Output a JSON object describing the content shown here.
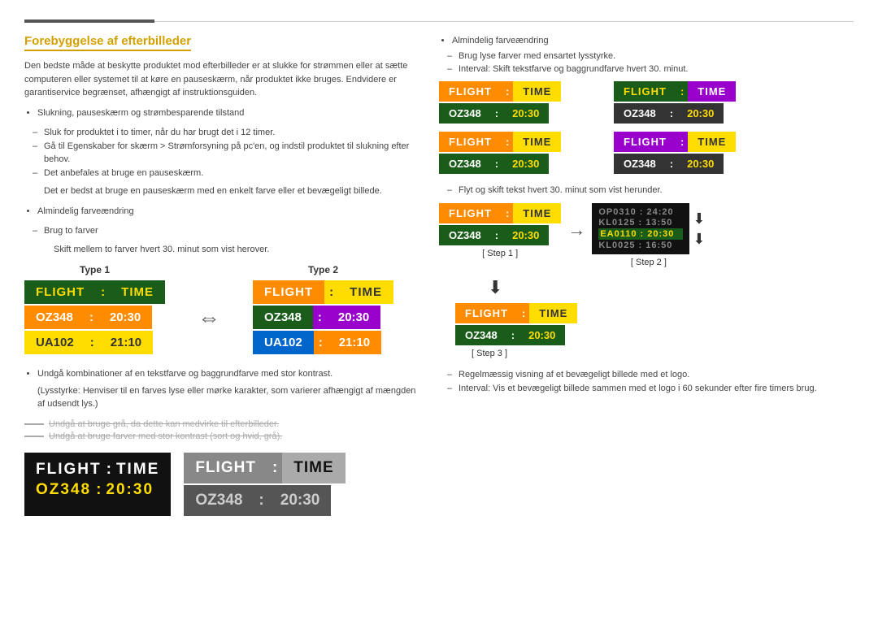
{
  "page": {
    "title": "Forebyggelse af efterbilleder"
  },
  "header": {
    "intro": "Den bedste måde at beskytte produktet mod efterbilleder er at slukke for strømmen eller at sætte computeren eller systemet til at køre en pauseskærm, når produktet ikke bruges. Endvidere er garantiservice begrænset, afhængigt af instruktionsguiden."
  },
  "left": {
    "bullet1": "Slukning, pauseskærm og strømbesparende tilstand",
    "dash1a": "Sluk for produktet i to timer, når du har brugt det i 12 timer.",
    "dash1b": "Gå til Egenskaber for skærm > Strømforsyning på pc'en, og indstil produktet til slukning efter behov.",
    "dash1c": "Det anbefales at bruge en pauseskærm.",
    "dash1c2": "Det er bedst at bruge en pauseskærm med en enkelt farve eller et bevægeligt billede.",
    "bullet2": "Almindelig farveændring",
    "dash2a": "Brug to farver",
    "dash2a2": "Skift mellem to farver hvert 30. minut som vist herover.",
    "type1_label": "Type 1",
    "type2_label": "Type 2",
    "board1": {
      "header": [
        "FLIGHT",
        ":",
        "TIME"
      ],
      "row1": [
        "OZ348",
        ":",
        "20:30"
      ],
      "row2": [
        "UA102",
        ":",
        "21:10"
      ]
    },
    "board2": {
      "header": [
        "FLIGHT",
        ":",
        "TIME"
      ],
      "row1": [
        "OZ348",
        ":",
        "20:30"
      ],
      "row2": [
        "UA102",
        ":",
        "21:10"
      ]
    },
    "bullet3": "Undgå kombinationer af en tekstfarve og baggrundfarve med stor kontrast.",
    "bullet3sub": "(Lysstyrke: Henviser til en farves lyse eller mørke karakter, som varierer afhængigt af mængden af udsendt lys.)",
    "warning1": "Undgå at bruge grå, da dette kan medvirke til efterbilleder.",
    "warning2": "Undgå at bruge farver med stor kontrast (sort og hvid, grå).",
    "bottom_board1": {
      "header_left": "FLIGHT",
      "header_dot": ":",
      "header_right": "TIME",
      "row_left": "OZ348",
      "row_dot": ":",
      "row_right": "20:30"
    },
    "bottom_board2": {
      "header_left": "FLIGHT",
      "header_dot": ":",
      "header_right": "TIME",
      "row_left": "OZ348",
      "row_dot": ":",
      "row_right": "20:30"
    }
  },
  "right": {
    "bullet_main": "Almindelig farveændring",
    "dash_r1": "Brug lyse farver med ensartet lysstyrke.",
    "dash_r2": "Interval: Skift tekstfarve og baggrundfarve hvert 30. minut.",
    "boards": [
      {
        "id": "mb1",
        "header": [
          "FLIGHT",
          ":",
          "TIME"
        ],
        "row": [
          "OZ348",
          ":",
          "20:30"
        ]
      },
      {
        "id": "mb2",
        "header": [
          "FLIGHT",
          ":",
          "TIME"
        ],
        "row": [
          "OZ348",
          ":",
          "20:30"
        ]
      },
      {
        "id": "mb3",
        "header": [
          "FLIGHT",
          ":",
          "TIME"
        ],
        "row": [
          "OZ348",
          ":",
          "20:30"
        ]
      },
      {
        "id": "mb4",
        "header": [
          "FLIGHT",
          ":",
          "TIME"
        ],
        "row": [
          "OZ348",
          ":",
          "20:30"
        ]
      }
    ],
    "dash_scroll": "Flyt og skift tekst hvert 30. minut som vist herunder.",
    "step1_label": "[ Step 1 ]",
    "step2_label": "[ Step 2 ]",
    "step3_label": "[ Step 3 ]",
    "step1_board": {
      "header": [
        "FLIGHT",
        ":",
        "TIME"
      ],
      "row": [
        "OZ348",
        ":",
        "20:30"
      ]
    },
    "step2_scroll": [
      "OP0310 : 24:20",
      "KL0125 : 13:50",
      "EA0110 : 20:30",
      "KL0025 : 16:50"
    ],
    "step3_board": {
      "header": [
        "FLIGHT",
        ":",
        "TIME"
      ],
      "row": [
        "OZ348",
        ":",
        "20:30"
      ]
    },
    "dash_logo": "Regelmæssig visning af et bevægeligt billede med et logo.",
    "dash_logo2": "Interval: Vis et bevægeligt billede sammen med et logo i 60 sekunder efter fire timers brug."
  }
}
